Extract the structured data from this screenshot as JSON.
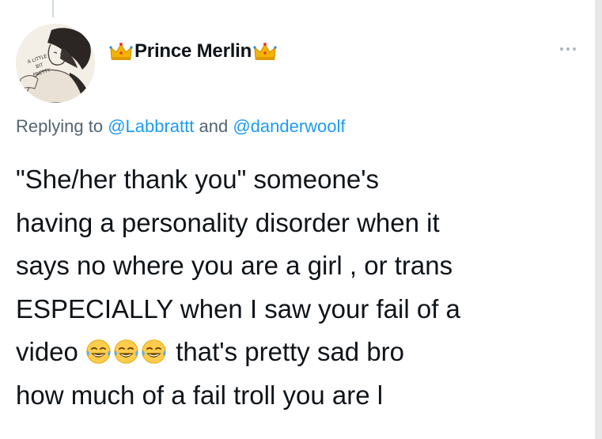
{
  "author": {
    "display_name": "Prince Merlin",
    "name_decoration": "crown-emoji",
    "avatar_text": [
      "A LITTLE",
      "BIT",
      "PRETTY"
    ]
  },
  "reply": {
    "prefix": "Replying to ",
    "mention1": "@Labbrattt",
    "joiner": " and ",
    "mention2": "@danderwoolf"
  },
  "tweet": {
    "line1": "\"She/her thank you\" someone's",
    "line2": "having a personality disorder when it",
    "line3": "says no where you are a girl , or trans",
    "line4": "ESPECIALLY when I saw your fail of a",
    "line5_before": "video ",
    "line5_after": " that's pretty sad bro",
    "line6": "how much of a fail troll you are l",
    "emojis": [
      "crying-laughing-emoji",
      "crying-laughing-emoji",
      "crying-laughing-emoji"
    ]
  },
  "colors": {
    "link": "#1d9bf0",
    "secondary_text": "#536471",
    "primary_text": "#0f1419"
  }
}
